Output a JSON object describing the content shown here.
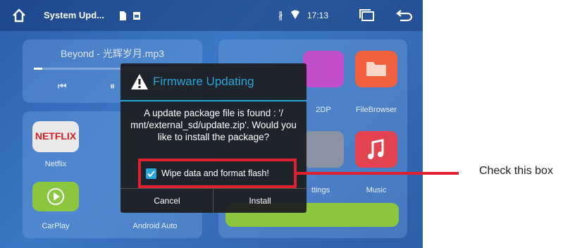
{
  "status_bar": {
    "app_title": "System Upd...",
    "time": "17:13",
    "icons": [
      "home-icon",
      "sd-card-icon",
      "image-icon",
      "bluetooth-icon",
      "wifi-icon",
      "recent-apps-icon",
      "back-icon"
    ]
  },
  "music": {
    "track": "Beyond - 光辉岁月.mp3"
  },
  "apps": [
    {
      "label": "Netflix"
    },
    {
      "label": "CarPlay"
    },
    {
      "label": "Android Auto"
    },
    {
      "label": "2DP"
    },
    {
      "label": "FileBrowser"
    },
    {
      "label": "ttings"
    },
    {
      "label": "Music"
    }
  ],
  "netflix_logo": "NETFLIX",
  "dialog": {
    "title": "Firmware Updating",
    "message": "A update package file is found : '/ mnt/external_sd/update.zip'. Would you like to install the package?",
    "checkbox_label": "Wipe data and format flash!",
    "checkbox_checked": true,
    "cancel": "Cancel",
    "install": "Install"
  },
  "callout": {
    "text": "Check this box",
    "color": "#e0202e"
  },
  "colors": {
    "accent": "#29a6d8",
    "highlight": "#e0202e",
    "netflix": "#d81f26",
    "carplay": "#8cc63f"
  }
}
